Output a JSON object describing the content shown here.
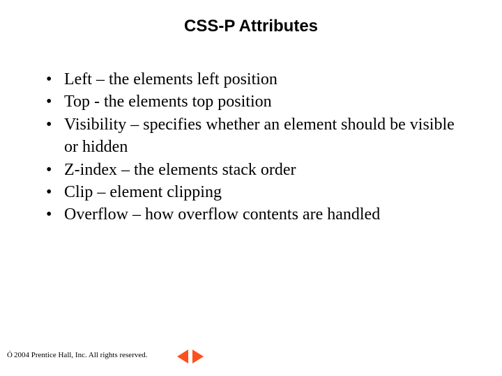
{
  "title": "CSS-P Attributes",
  "bullets": [
    "Left – the elements left position",
    "Top - the elements top position",
    "Visibility – specifies whether an element should be visible or hidden",
    "Z-index – the elements stack order",
    "Clip – element clipping",
    "Overflow – how overflow contents are handled"
  ],
  "footer": {
    "copyright_symbol": "Ó",
    "text": " 2004 Prentice Hall, Inc.  All rights reserved."
  }
}
